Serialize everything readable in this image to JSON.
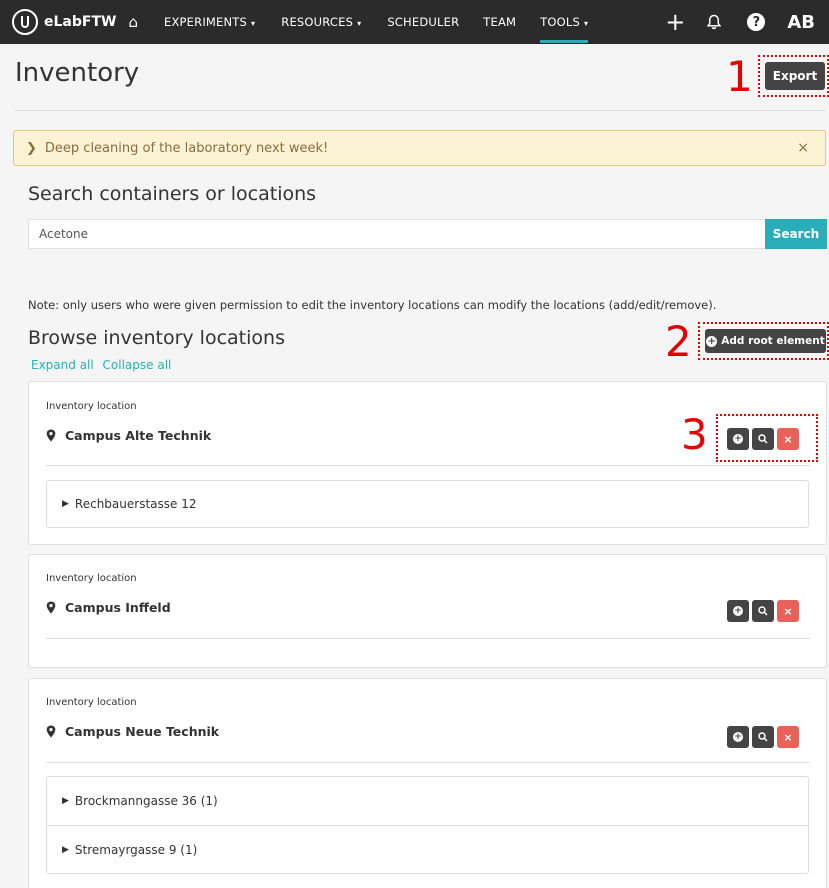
{
  "navbar": {
    "brand": "eLabFTW",
    "items": [
      {
        "label": "EXPERIMENTS",
        "caret": "▾"
      },
      {
        "label": "RESOURCES",
        "caret": "▾"
      },
      {
        "label": "SCHEDULER",
        "caret": ""
      },
      {
        "label": "TEAM",
        "caret": ""
      },
      {
        "label": "TOOLS",
        "caret": "▾"
      }
    ],
    "avatar": "AB",
    "help": "?"
  },
  "page": {
    "title": "Inventory",
    "export_label": "Export"
  },
  "annotations": [
    "1",
    "2",
    "3"
  ],
  "alert": {
    "text": "Deep cleaning of the laboratory next week!",
    "close": "×"
  },
  "search": {
    "title": "Search containers or locations",
    "value": "Acetone",
    "button": "Search"
  },
  "note": "Note: only users who were given permission to edit the inventory locations can modify the locations (add/edit/remove).",
  "browse": {
    "title": "Browse inventory locations",
    "add_root_label": "Add root element",
    "expand_all": "Expand all",
    "collapse_all": "Collapse all"
  },
  "locations": [
    {
      "label": "Inventory location",
      "name": "Campus Alte Technik",
      "children": [
        "Rechbauerstasse 12"
      ]
    },
    {
      "label": "Inventory location",
      "name": "Campus Inffeld",
      "children": []
    },
    {
      "label": "Inventory location",
      "name": "Campus Neue Technik",
      "children": [
        "Brockmanngasse 36 (1)",
        "Stremayrgasse 9 (1)"
      ]
    }
  ],
  "colors": {
    "accent": "#29aeb9",
    "danger": "#e8625a",
    "annotation": "#e30000"
  }
}
